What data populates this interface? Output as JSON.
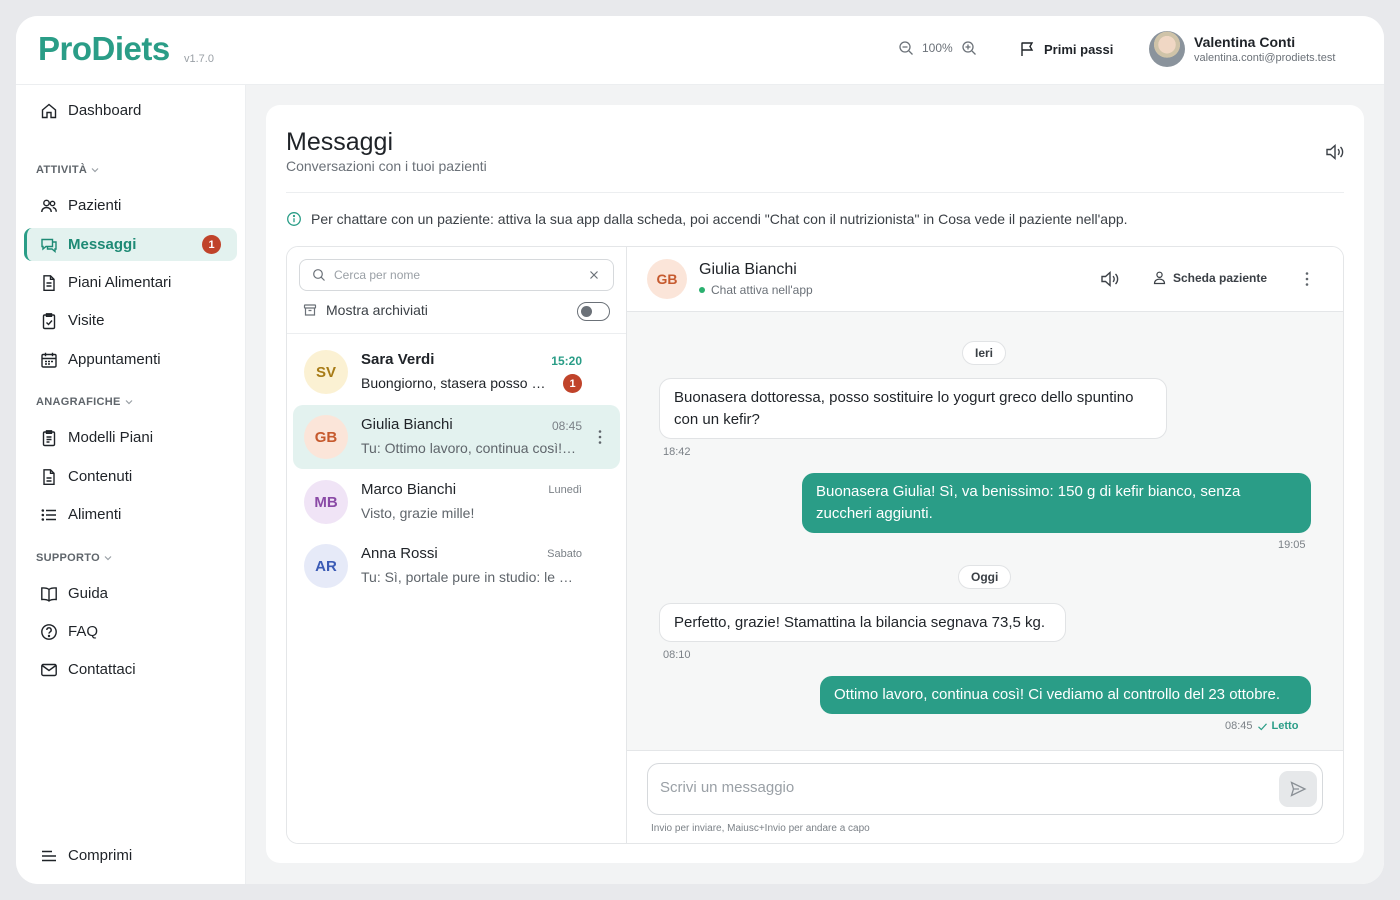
{
  "app": {
    "name": "ProDiets",
    "version": "v1.7.0"
  },
  "topbar": {
    "zoom": "100%",
    "guide_label": "Primi passi",
    "user": {
      "name": "Valentina Conti",
      "email": "valentina.conti@prodiets.test"
    }
  },
  "sidebar": {
    "dashboard": "Dashboard",
    "section_activity": "ATTIVITÀ",
    "pazienti": "Pazienti",
    "messaggi": "Messaggi",
    "messaggi_badge": "1",
    "piani": "Piani Alimentari",
    "visite": "Visite",
    "appuntamenti": "Appuntamenti",
    "section_registry": "ANAGRAFICHE",
    "modelli": "Modelli Piani",
    "contenuti": "Contenuti",
    "alimenti": "Alimenti",
    "section_support": "SUPPORTO",
    "guida": "Guida",
    "faq": "FAQ",
    "contattaci": "Contattaci",
    "collapse": "Comprimi"
  },
  "page": {
    "title": "Messaggi",
    "subtitle": "Conversazioni con i tuoi pazienti",
    "info": "Per chattare con un paziente: attiva la sua app dalla scheda, poi accendi \"Chat con il nutrizionista\" in Cosa vede il paziente nell'app."
  },
  "list": {
    "search_placeholder": "Cerca per nome",
    "archived_label": "Mostra archiviati",
    "archived_on": false,
    "conversations": [
      {
        "initials": "SV",
        "name": "Sara Verdi",
        "time": "15:20",
        "preview": "Buongiorno, stasera posso sostituire il pesce?",
        "unread": "1",
        "colors": {
          "bg": "#fbf1d3",
          "fg": "#a77b16"
        }
      },
      {
        "initials": "GB",
        "name": "Giulia Bianchi",
        "time": "08:45",
        "preview": "Tu: Ottimo lavoro, continua così! Ci vediamo al controllo",
        "unread": "",
        "colors": {
          "bg": "#fbe5d9",
          "fg": "#c65a2e"
        }
      },
      {
        "initials": "MB",
        "name": "Marco Bianchi",
        "time": "Lunedì",
        "preview": "Visto, grazie mille!",
        "unread": "",
        "colors": {
          "bg": "#f0e4f6",
          "fg": "#8a4aa6"
        }
      },
      {
        "initials": "AR",
        "name": "Anna Rossi",
        "time": "Sabato",
        "preview": "Tu: Sì, portale pure in studio: le guardiamo insieme",
        "unread": "",
        "colors": {
          "bg": "#e6eaf8",
          "fg": "#3b5bb5"
        }
      }
    ]
  },
  "thread": {
    "initials": "GB",
    "name": "Giulia Bianchi",
    "status": "Chat attiva nell'app",
    "patient_card": "Scheda paziente",
    "days": [
      "Ieri",
      "Oggi"
    ],
    "messages": [
      {
        "dir": "in",
        "text": "Buonasera dottoressa, posso sostituire lo yogurt greco dello spuntino con un kefir?",
        "time": "18:42"
      },
      {
        "dir": "out",
        "text": "Buonasera Giulia! Sì, va benissimo: 150 g di kefir bianco, senza zuccheri aggiunti.",
        "time": "19:05"
      },
      {
        "dir": "in",
        "text": "Perfetto, grazie! Stamattina la bilancia segnava 73,5 kg.",
        "time": "08:10"
      },
      {
        "dir": "out",
        "text": "Ottimo lavoro, continua così! Ci vediamo al controllo del 23 ottobre.",
        "time": "08:45",
        "read": "Letto"
      }
    ],
    "composer_placeholder": "Scrivi un messaggio",
    "composer_hint": "Invio per inviare, Maiusc+Invio per andare a capo"
  },
  "colors": {
    "accent": "#2a9d87",
    "badge": "#c0432a"
  }
}
